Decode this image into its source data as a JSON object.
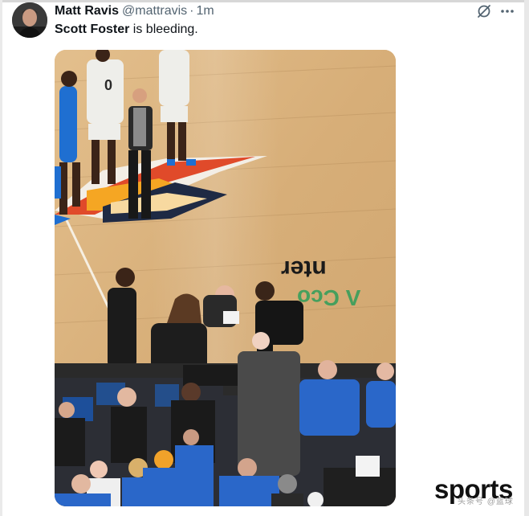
{
  "tweet": {
    "display_name": "Matt Ravis",
    "handle": "@mattravis",
    "separator": "·",
    "time": "1m",
    "mention": "Scott Foster",
    "text_rest": " is bleeding."
  },
  "media": {
    "court_lettering": "nter",
    "court_lettering_green": "Λ Cco"
  },
  "watermark": {
    "brand": "sports",
    "sub": "头条号 @篮球"
  },
  "icons": {
    "grok": "grok-icon",
    "more": "more-icon"
  },
  "colors": {
    "text_primary": "#0f1419",
    "text_secondary": "#536471",
    "court_wood": "#d9b07a",
    "thunder_blue": "#1f6fd1",
    "crowd_blue": "#2a67c9"
  }
}
